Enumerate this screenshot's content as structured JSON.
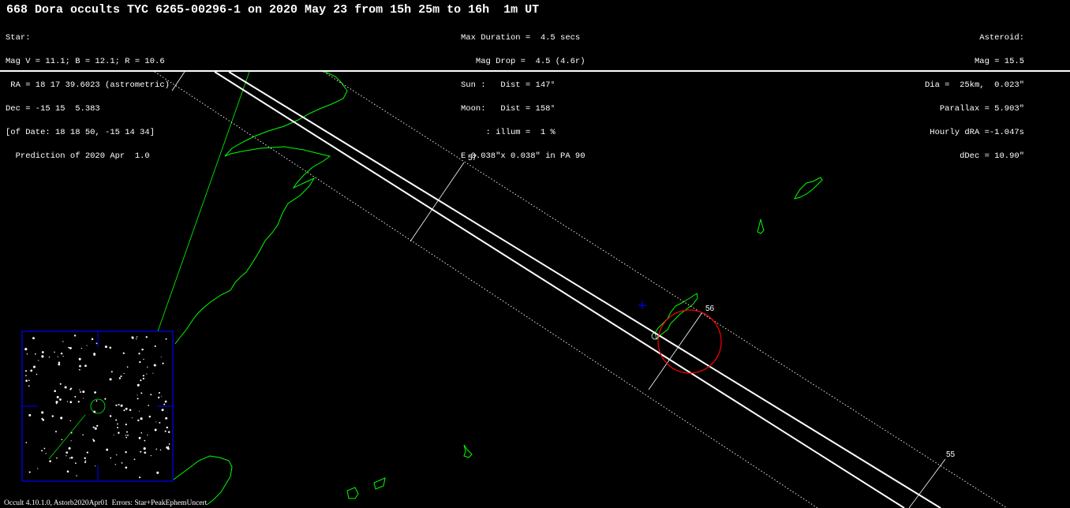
{
  "title": "668 Dora occults TYC 6265-00296-1 on 2020 May 23 from 15h 25m to 16h  1m UT",
  "star_block": [
    "Star:",
    "Mag V = 11.1; B = 12.1; R = 10.6",
    " RA = 18 17 39.6023 (astrometric)",
    "Dec = -15 15  5.383",
    "[of Date: 18 18 50, -15 14 34]",
    "  Prediction of 2020 Apr  1.0"
  ],
  "event_block": [
    "Max Duration =  4.5 secs",
    "   Mag Drop =  4.5 (4.6r)",
    "Sun :   Dist = 147°",
    "Moon:   Dist = 158°",
    "     : illum =  1 %",
    "E 0.038\"x 0.038\" in PA 90"
  ],
  "asteroid_block": [
    "Asteroid:",
    "Mag = 15.5",
    "Dia =  25km,  0.023\"",
    "Parallax = 5.903\"",
    "Hourly dRA =-1.047s",
    "dDec = 10.90\""
  ],
  "time_ticks": {
    "t57": "57",
    "t56": "56",
    "t55": "55"
  },
  "footer": "Occult 4.10.1.0, Astorb2020Apr01  Errors: Star+PeakEphemUncert",
  "colors": {
    "background": "#000000",
    "path_lines": "#ffffff",
    "coastline": "#00ff00",
    "error_circle": "#ff0000",
    "star_marker": "#0000ff",
    "inset_frame": "#0000ff"
  }
}
